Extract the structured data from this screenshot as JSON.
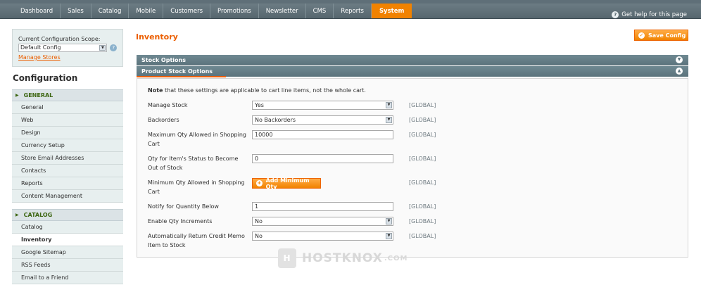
{
  "nav": {
    "items": [
      "Dashboard",
      "Sales",
      "Catalog",
      "Mobile",
      "Customers",
      "Promotions",
      "Newsletter",
      "CMS",
      "Reports",
      "System"
    ],
    "active": "System",
    "help": "Get help for this page"
  },
  "sidebar": {
    "scope_label": "Current Configuration Scope:",
    "scope_value": "Default Config",
    "manage_stores": "Manage Stores",
    "title": "Configuration",
    "group_general": "GENERAL",
    "general_items": [
      "General",
      "Web",
      "Design",
      "Currency Setup",
      "Store Email Addresses",
      "Contacts",
      "Reports",
      "Content Management"
    ],
    "group_catalog": "CATALOG",
    "catalog_items": [
      "Catalog",
      "Inventory",
      "Google Sitemap",
      "RSS Feeds",
      "Email to a Friend"
    ],
    "active_item": "Inventory"
  },
  "main": {
    "title": "Inventory",
    "save_button": "Save Config",
    "section_stock": "Stock Options",
    "section_product": "Product Stock Options",
    "note_bold": "Note",
    "note_text": " that these settings are applicable to cart line items, not the whole cart.",
    "fields": [
      {
        "label": "Manage Stock",
        "value": "Yes",
        "type": "select",
        "scope": "[GLOBAL]"
      },
      {
        "label": "Backorders",
        "value": "No Backorders",
        "type": "select",
        "scope": "[GLOBAL]"
      },
      {
        "label": "Maximum Qty Allowed in Shopping Cart",
        "value": "10000",
        "type": "input",
        "scope": "[GLOBAL]"
      },
      {
        "label": "Qty for Item's Status to Become Out of Stock",
        "value": "0",
        "type": "input",
        "scope": "[GLOBAL]"
      },
      {
        "label": "Minimum Qty Allowed in Shopping Cart",
        "value": "Add Minimum Qty",
        "type": "button",
        "scope": "[GLOBAL]"
      },
      {
        "label": "Notify for Quantity Below",
        "value": "1",
        "type": "input",
        "scope": "[GLOBAL]"
      },
      {
        "label": "Enable Qty Increments",
        "value": "No",
        "type": "select",
        "scope": "[GLOBAL]"
      },
      {
        "label": "Automatically Return Credit Memo Item to Stock",
        "value": "No",
        "type": "select",
        "scope": "[GLOBAL]"
      }
    ]
  },
  "watermark": {
    "brand": "HOSTKNOX",
    "suffix": ".COM"
  }
}
